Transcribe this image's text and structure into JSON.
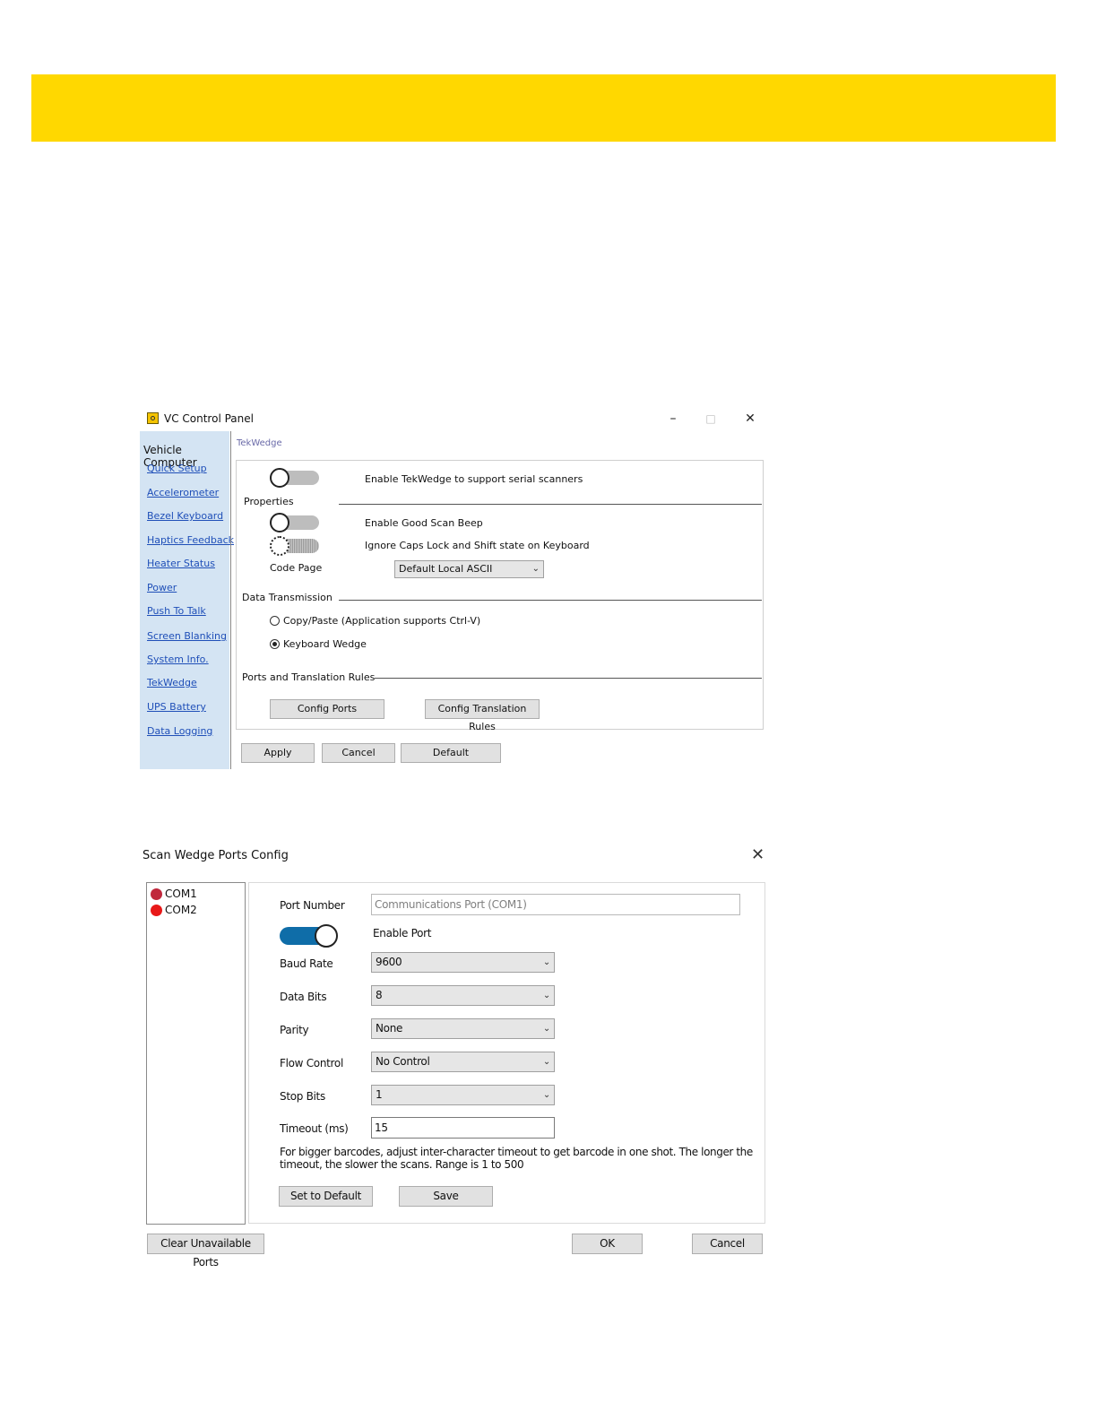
{
  "colors": {
    "banner": "#FFD800",
    "toggle_on": "#0f6da8",
    "port_com1": "#c0283c",
    "port_com2": "#e81818",
    "sidebar": "#d4e4f3"
  },
  "vc_panel": {
    "title": "VC Control Panel",
    "window_controls": {
      "minimize": "–",
      "maximize": "□",
      "close": "✕"
    },
    "sidebar": {
      "title": "Vehicle Computer",
      "items": [
        {
          "label": "Quick Setup"
        },
        {
          "label": "Accelerometer"
        },
        {
          "label": "Bezel Keyboard"
        },
        {
          "label": "Haptics Feedback"
        },
        {
          "label": "Heater Status"
        },
        {
          "label": "Power"
        },
        {
          "label": "Push To Talk"
        },
        {
          "label": "Screen Blanking"
        },
        {
          "label": "System Info."
        },
        {
          "label": "TekWedge"
        },
        {
          "label": "UPS Battery"
        },
        {
          "label": "Data Logging"
        }
      ]
    },
    "breadcrumb": "TekWedge",
    "enable_tekwedge": {
      "label": "Enable TekWedge to support serial scanners",
      "state": "off"
    },
    "properties": {
      "heading": "Properties",
      "good_scan_beep": {
        "label": "Enable Good Scan Beep",
        "state": "off"
      },
      "ignore_caps": {
        "label": "Ignore Caps Lock and Shift state on Keyboard",
        "state": "off"
      },
      "code_page": {
        "label": "Code Page",
        "value": "Default Local ASCII"
      }
    },
    "data_transmission": {
      "heading": "Data Transmission",
      "options": [
        {
          "label": "Copy/Paste (Application supports Ctrl-V)",
          "selected": false
        },
        {
          "label": "Keyboard Wedge",
          "selected": true
        }
      ]
    },
    "ports_rules": {
      "heading": "Ports and Translation Rules",
      "config_ports": "Config Ports",
      "config_rules": "Config Translation Rules"
    },
    "buttons": {
      "apply": "Apply",
      "cancel": "Cancel",
      "default": "Default"
    }
  },
  "ports_config": {
    "title": "Scan Wedge Ports Config",
    "close": "✕",
    "ports": [
      {
        "name": "COM1",
        "selected": true
      },
      {
        "name": "COM2",
        "selected": false
      }
    ],
    "fields": {
      "port_number": {
        "label": "Port Number",
        "value": "Communications Port (COM1)"
      },
      "enable_port": {
        "label": "Enable Port",
        "state": "on"
      },
      "baud_rate": {
        "label": "Baud Rate",
        "value": "9600"
      },
      "data_bits": {
        "label": "Data Bits",
        "value": "8"
      },
      "parity": {
        "label": "Parity",
        "value": "None"
      },
      "flow_control": {
        "label": "Flow Control",
        "value": "No Control"
      },
      "stop_bits": {
        "label": "Stop Bits",
        "value": "1"
      },
      "timeout": {
        "label": "Timeout (ms)",
        "value": "15"
      }
    },
    "note": "For bigger barcodes, adjust inter-character timeout to get barcode in one shot. The longer the timeout, the slower the scans. Range is 1 to 500",
    "buttons": {
      "set_default": "Set to Default",
      "save": "Save",
      "clear_unavailable": "Clear Unavailable Ports",
      "ok": "OK",
      "cancel": "Cancel"
    }
  }
}
